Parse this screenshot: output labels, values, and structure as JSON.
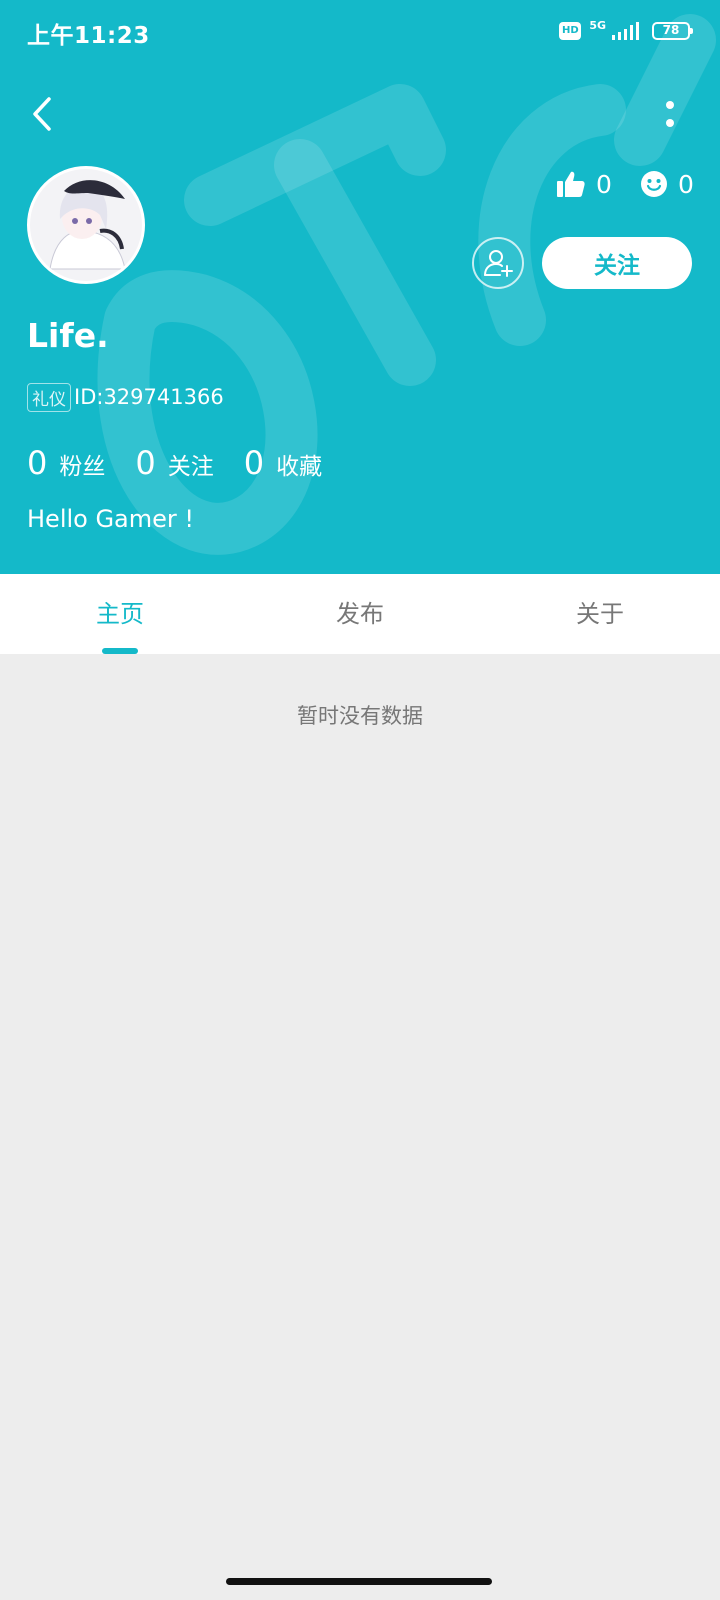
{
  "status_bar": {
    "time": "上午11:23",
    "hd": "HD",
    "network": "5G",
    "battery": "78"
  },
  "profile": {
    "name": "Life.",
    "tag": "礼仪",
    "id_text": "ID:329741366",
    "bio": "Hello Gamer !",
    "likes": "0",
    "smiles": "0",
    "follow_label": "关注",
    "stats": [
      {
        "count": "0",
        "label": "粉丝"
      },
      {
        "count": "0",
        "label": "关注"
      },
      {
        "count": "0",
        "label": "收藏"
      }
    ]
  },
  "tabs": [
    {
      "label": "主页",
      "active": true
    },
    {
      "label": "发布",
      "active": false
    },
    {
      "label": "关于",
      "active": false
    }
  ],
  "content": {
    "empty_text": "暂时没有数据"
  },
  "colors": {
    "accent": "#14b9c9",
    "background": "#ededed"
  }
}
